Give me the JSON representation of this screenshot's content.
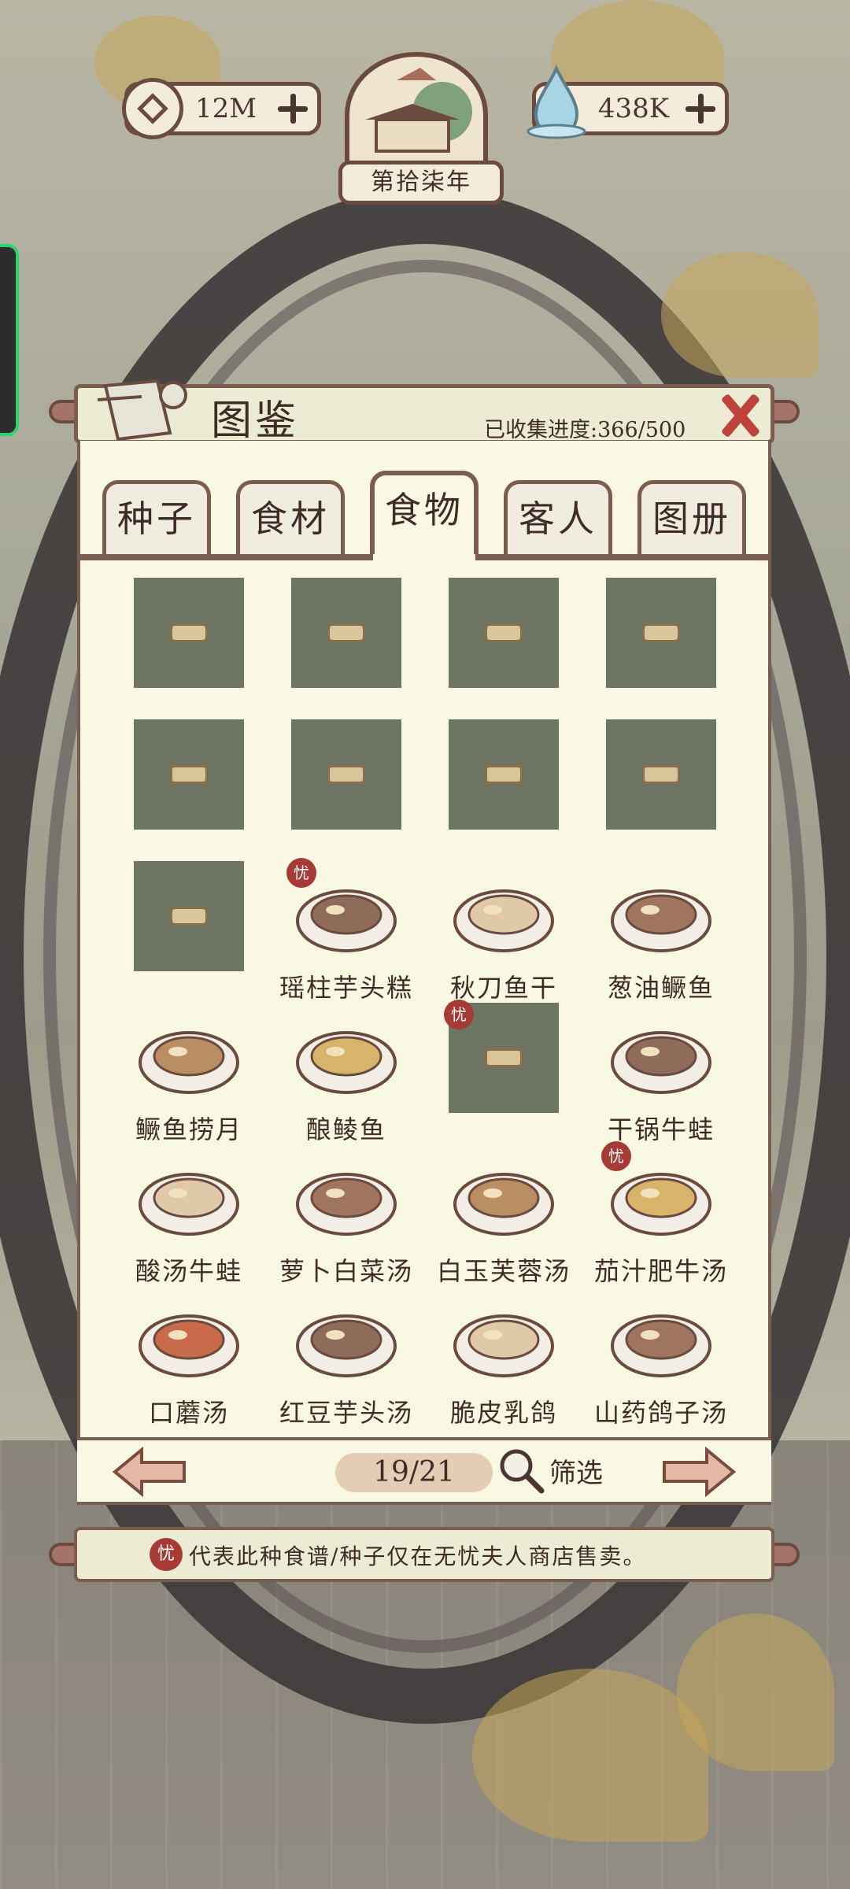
{
  "top_bar": {
    "coins": "12M",
    "water": "438K",
    "year": "第拾柒年"
  },
  "panel": {
    "title": "图鉴",
    "progress": "已收集进度:366/500",
    "tabs": [
      {
        "label": "种子",
        "active": false
      },
      {
        "label": "食材",
        "active": false
      },
      {
        "label": "食物",
        "active": true
      },
      {
        "label": "客人",
        "active": false
      },
      {
        "label": "图册",
        "active": false
      }
    ]
  },
  "items": [
    {
      "label": "",
      "state": "locked"
    },
    {
      "label": "",
      "state": "locked"
    },
    {
      "label": "",
      "state": "locked"
    },
    {
      "label": "",
      "state": "locked"
    },
    {
      "label": "",
      "state": "locked"
    },
    {
      "label": "",
      "state": "locked"
    },
    {
      "label": "",
      "state": "locked"
    },
    {
      "label": "",
      "state": "locked"
    },
    {
      "label": "",
      "state": "locked"
    },
    {
      "label": "瑶柱芋头糕",
      "state": "unlocked",
      "badge": true
    },
    {
      "label": "秋刀鱼干",
      "state": "unlocked"
    },
    {
      "label": "葱油鳜鱼",
      "state": "unlocked"
    },
    {
      "label": "鳜鱼捞月",
      "state": "unlocked"
    },
    {
      "label": "酿鲮鱼",
      "state": "unlocked"
    },
    {
      "label": "",
      "state": "locked",
      "badge": true
    },
    {
      "label": "干锅牛蛙",
      "state": "unlocked"
    },
    {
      "label": "酸汤牛蛙",
      "state": "unlocked"
    },
    {
      "label": "萝卜白菜汤",
      "state": "unlocked"
    },
    {
      "label": "白玉芙蓉汤",
      "state": "unlocked"
    },
    {
      "label": "茄汁肥牛汤",
      "state": "unlocked",
      "badge": true
    },
    {
      "label": "口蘑汤",
      "state": "unlocked"
    },
    {
      "label": "红豆芋头汤",
      "state": "unlocked"
    },
    {
      "label": "脆皮乳鸽",
      "state": "unlocked"
    },
    {
      "label": "山药鸽子汤",
      "state": "unlocked"
    }
  ],
  "badge_char": "忧",
  "pagination": {
    "page": "19/21",
    "filter_label": "筛选"
  },
  "notice": "代表此种食谱/种子仅在无忧夫人商店售卖。",
  "colors": {
    "accent": "#7a5d4f",
    "badge": "#a63a35",
    "panel": "#f9f8e3",
    "locked_tile": "#6e7562"
  }
}
